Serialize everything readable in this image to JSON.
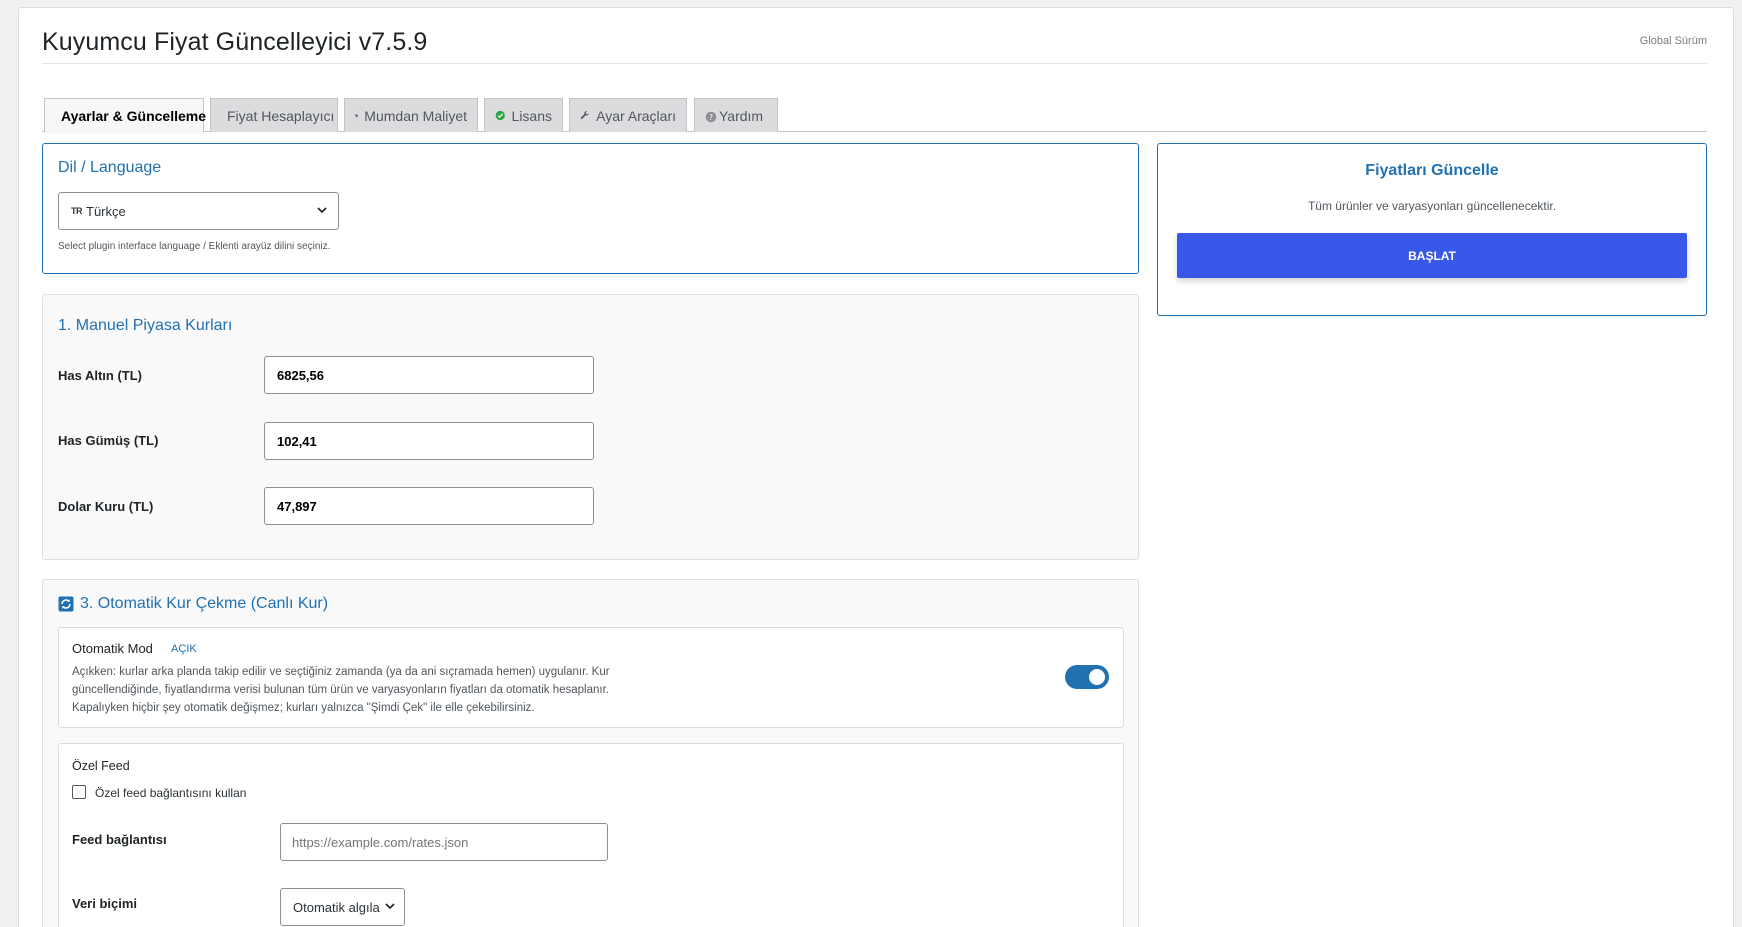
{
  "header": {
    "title": "Kuyumcu Fiyat Güncelleyici v7.5.9",
    "edition": "Global Sürüm"
  },
  "tabs": [
    {
      "label": "Ayarlar & Güncelleme",
      "icon": "settings-grid-icon",
      "active": true
    },
    {
      "label": "Fiyat Hesaplayıcı",
      "icon": "calculator-icon",
      "active": false
    },
    {
      "label": "Mumdan Maliyet",
      "icon": "pie-chart-icon",
      "active": false
    },
    {
      "label": "Lisans",
      "icon": "check-circle-icon",
      "active": false
    },
    {
      "label": "Ayar Araçları",
      "icon": "wrench-icon",
      "active": false
    },
    {
      "label": "Yardım",
      "icon": "help-icon",
      "active": false
    }
  ],
  "language": {
    "heading": "Dil / Language",
    "flag": "TR",
    "selected": "Türkçe",
    "description": "Select plugin interface language / Eklenti arayüz dilini seçiniz."
  },
  "update_panel": {
    "heading": "Fiyatları Güncelle",
    "description": "Tüm ürünler ve varyasyonları güncellenecektir.",
    "button_label": "BAŞLAT"
  },
  "manual_rates": {
    "heading": "1. Manuel Piyasa Kurları",
    "fields": [
      {
        "label": "Has Altın (TL)",
        "value": "6825,56"
      },
      {
        "label": "Has Gümüş (TL)",
        "value": "102,41"
      },
      {
        "label": "Dolar Kuru (TL)",
        "value": "47,897"
      }
    ]
  },
  "auto_rates": {
    "heading": "3. Otomatik Kur Çekme (Canlı Kur)",
    "auto_mode_label": "Otomatik Mod",
    "auto_mode_status": "AÇIK",
    "auto_mode_enabled": true,
    "description_lines": [
      "Açıkken: kurlar arka planda takip edilir ve seçtiğiniz zamanda (ya da ani sıçramada hemen) uygulanır. Kur",
      "güncellendiğinde, fiyatlandırma verisi bulunan tüm ürün ve varyasyonların fiyatları da otomatik hesaplanır.",
      "Kapalıyken hiçbir şey otomatik değişmez; kurları yalnızca \"Şimdi Çek\" ile elle çekebilirsiniz."
    ],
    "custom_feed": {
      "title": "Özel Feed",
      "checkbox_label": "Özel feed bağlantısını kullan",
      "checkbox_checked": false,
      "url_label": "Feed bağlantısı",
      "url_placeholder": "https://example.com/rates.json",
      "url_value": "",
      "format_label": "Veri biçimi",
      "format_selected": "Otomatik algıla"
    }
  },
  "colors": {
    "accent": "#2271b1",
    "button": "#3858e9"
  }
}
